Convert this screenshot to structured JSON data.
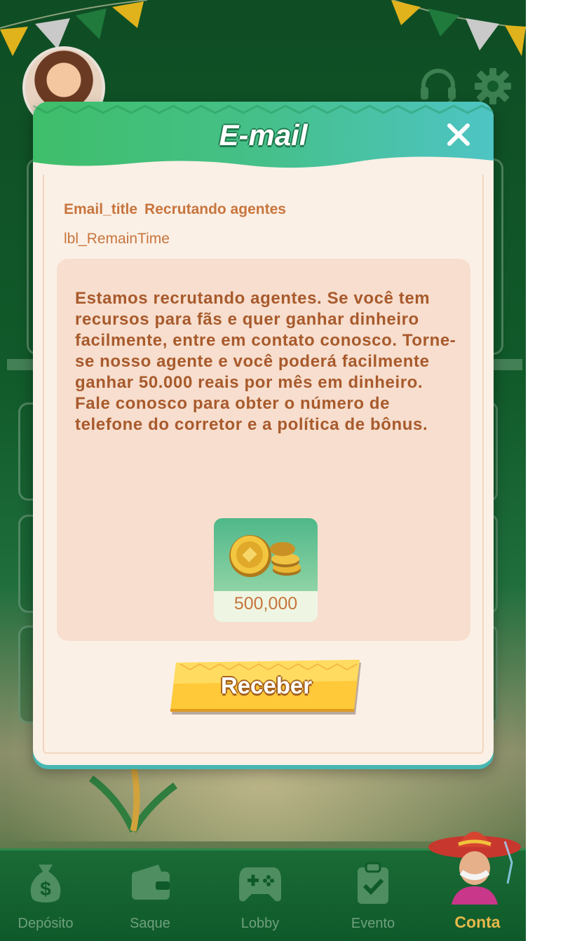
{
  "dialog": {
    "title": "E-mail",
    "close_icon": "close-icon",
    "subject_prefix": "Email_title",
    "subject": "Recrutando agentes",
    "remain_time": "lbl_RemainTime",
    "message": "Estamos recrutando agentes. Se você tem recursos para fãs e quer ganhar dinheiro facilmente, entre em contato conosco. Torne-se nosso agente e você poderá facilmente ganhar 50.000 reais por mês em dinheiro. Fale conosco para obter o número de telefone do corretor e a política de bônus.",
    "reward": {
      "icon": "gold-coins-icon",
      "amount": "500,000"
    },
    "receive_label": "Receber"
  },
  "bottom_nav": {
    "items": [
      {
        "label": "Depósito",
        "icon": "money-bag-icon"
      },
      {
        "label": "Saque",
        "icon": "wallet-icon"
      },
      {
        "label": "Lobby",
        "icon": "gamepad-icon"
      },
      {
        "label": "Evento",
        "icon": "clipboard-check-icon"
      },
      {
        "label": "Conta",
        "icon": "mascot-avatar",
        "active": true
      }
    ]
  },
  "colors": {
    "header_green": "#3fbe6a",
    "header_teal": "#4ec4c4",
    "text_brown": "#c7753d",
    "message_brown": "#a85a2c",
    "button_yellow": "#ffc93a",
    "active_nav": "#e8b84a"
  }
}
